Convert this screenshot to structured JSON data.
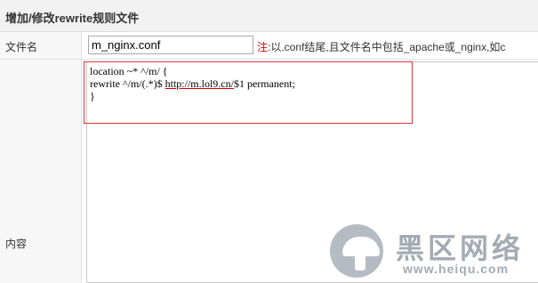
{
  "header": {
    "title": "增加/修改rewrite规则文件"
  },
  "filename_row": {
    "label": "文件名",
    "input_value": "m_nginx.conf",
    "hint_prefix": "注:",
    "hint_text": "以.conf结尾,且文件名中包括_apache或_nginx,如c"
  },
  "content_row": {
    "label": "内容",
    "code_lines": [
      "location ~* ^/m/ {",
      "rewrite ^/m/(.*)$ ",
      "http://m.lol9.cn/",
      "$1 permanent;",
      "}"
    ]
  },
  "watermark": {
    "title": "黑区网络",
    "url": "www.heiqu.com"
  },
  "colors": {
    "highlight_box": "#d9363e",
    "hint_prefix": "#cc0000"
  }
}
